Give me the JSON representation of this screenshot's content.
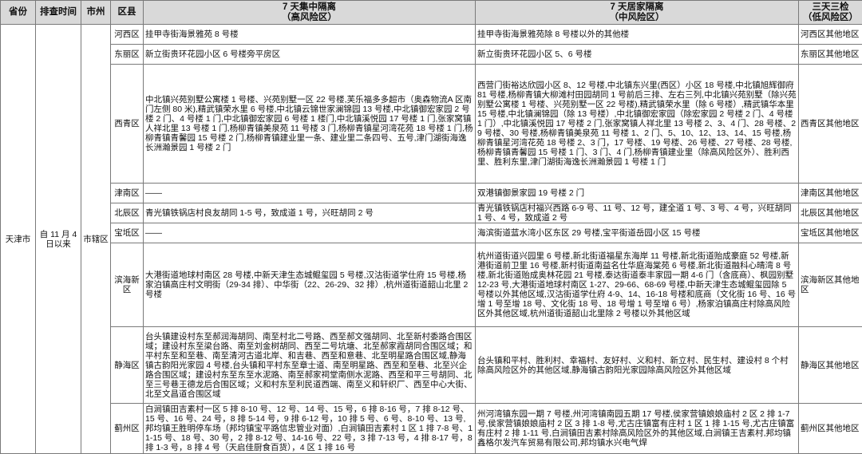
{
  "headers": {
    "province": "省份",
    "check_time": "排查时间",
    "city": "市州",
    "district": "区县",
    "centralized_line1": "7 天集中隔离",
    "centralized_line2": "（高风险区）",
    "home_line1": "7 天居家隔离",
    "home_line2": "（中风险区）",
    "three_day_line1": "三天三检",
    "three_day_line2": "（低风险区）"
  },
  "merged": {
    "province": "天津市",
    "check_time": "自 11 月 4 日以来",
    "city": "市辖区"
  },
  "rows": [
    {
      "district": "河西区",
      "high": "挂甲寺街海景雅苑 8 号楼",
      "mid": "挂甲寺街海景雅苑除 8 号楼以外的其他楼",
      "low": "河西区其他地区"
    },
    {
      "district": "东丽区",
      "high": "新立街贵环花园小区 6 号楼旁平房区",
      "mid": "新立街贵环花园小区 5、6 号楼",
      "low": "东丽区其他地区"
    },
    {
      "district": "西青区",
      "high": "中北镇兴苑别墅公寓楼 1 号楼、兴苑别墅一区 22 号楼,芙乐福多多超市（奥森物流A 区南门左侧 80 米),精武镇荣水里 6 号楼,中北镇云锦世家澜锦园 13 号楼,中北镇御宏家园 2 号楼 2 门、4 号楼 1 门,中北镇御宏家园 6 号楼 1 楼门,中北镇溪悦园 17 号楼 1 门,张家窝镇人祥北里 13 号楼 1 门,杨柳青镇美泉苑 11 号楼 3 门,杨柳青镇星河湾花苑 18 号楼 1 门,杨柳青镇青馨园 15 号楼 2 门,杨柳青镇建业里一条、建业里二条四号、五号,津门湖街海逸长洲瀚景园 1 号楼 2 门",
      "mid": "西营门街裕达欣园小区 8、12 号楼,中北镇东兴里(西区）小区 18 号楼,中北镇旭辉御府 81 号楼,杨柳青镇大柳滩村田园胡同 1 号前后三排、左右三列,中北镇兴苑别墅（除兴苑别墅公寓楼 1 号楼、兴苑别墅一区 22 号楼),精武镇荣水里（除 6 号楼）,精武镇华本里 15 号楼,中北镇澜锦园（除 13 号楼）,中北镇御宏家园（除宏家园 2 号楼 2 门、4 号楼 1 门）,中北镇溪悦园 17 号楼 2 门,张家窝镇人祥北里 13 号楼 2、3、4 门、28 号楼、29 号楼、30 号楼,杨柳青镇美泉苑 11 号楼 1、2 门、5、10、12、13、14、15 号楼,杨柳青镇星河湾花苑 18 号楼 2、3 门，17 号楼、19 号楼、26 号楼、27 号楼、28 号楼,杨柳青镇青馨园 15 号楼 1 门、3 门、4 门,杨柳青镇建业里（除高风险区外）、胜利西里、胜利东里,津门湖街海逸长洲瀚景园 1 号楼 1 门",
      "low": "西青区其他地区"
    },
    {
      "district": "津南区",
      "high": "——",
      "mid": "双港镇御景家园 19 号楼 2 门",
      "low": "津南区其他地区"
    },
    {
      "district": "北辰区",
      "high": "青光镇铁锅店村良友胡同 1-5 号，致成道 1 号，兴旺胡同 2 号",
      "mid": "青光镇铁锅店村福兴西路 6-9 号、11 号、12 号，建全道 1 号、3 号、4 号，兴旺胡同 1 号、4 号，致成道 2 号",
      "low": "北辰区其他地区"
    },
    {
      "district": "宝坻区",
      "high": "——",
      "mid": "海滨街道蓝水湾小区东区 29 号楼,宝平街道岳园小区 15 号楼",
      "low": "宝坻区其他地区"
    },
    {
      "district": "滨海新区",
      "high": "大港街道地球村南区 28 号楼,中新天津生态城鲲玺园 5 号楼,汉沽街道学仕府 15 号楼,杨家泊镇高庄村文明街（29-34 排）、中华街（22、26-29、32 排）,杭州道街道韶山北里 2 号楼",
      "mid": "杭州道街道兴园里 6 号楼,新北街道福星东海岸 11 号楼,新北街道贻成豪庭 52 号楼,新港街道前卫里 16 号楼,新村街道南益名仕华庭海棠苑 6 号楼,新北街道融科心晴湾 8 号楼,新北街道贻成奥林花园 21 号楼,泰达街道泰丰家园一期 4-6 门（含底商）、枫园别墅 12-23 号,大港街道地球村南区 1-27、29-66、68-69 号楼,中新天津生态城鲲玺园除 5 号楼以外其他区域,汉沽街道学仕府 4-9、14、16-18 号楼和底商（文化街 16 号、16 号增 1 号至增 18 号、文化街 18 号、18 号增 1 号至增 6 号）,杨家泊镇高庄村除高风险区外其他区域,杭州道街道韶山北里除 2 号楼以外其他区域",
      "low": "滨海新区其他地区"
    },
    {
      "district": "静海区",
      "high": "台头镇建设村东至郝润海胡同、南至村北二号路、西至郝文强胡同、北至新村委路合围区域；建设村东至梁台路、南至刘金树胡同、西至二号坑塘、北至郝家霞胡同合围区域；和平村东至和至巷、南至清河古道北岸、和吉巷、西至和意巷、北至明星路合围区域,静海镇古韵阳光家园 4 号楼,台头镇和平村东至章士道、南至明星路、西至和至巷、北至兴企路合围区域；建设村东至东至水泥路、南至郝家祠堂南侧水泥路、西至和平三号胡同、北至三号巷王德龙后合围区域；义和村东至利民道西端、南至义和轩织厂、西至中心大街、北至文昌道合围区域",
      "mid": "台头镇和平村、胜利村、幸福村、友好村、义和村、新立村、民生村、建设村 8 个村除高风险区外的其他区域,静海镇古韵阳光家园除高风险区外其他区域",
      "low": "静海区其他地区"
    },
    {
      "district": "蓟州区",
      "high": "白涧镇田吉素村一区 5 排 8-10 号、12 号、14 号、15 号，6 排 8-16 号，7 排 8-12 号、15 号、16 号、24 号，8 排 5-14 号，9 排 6-12 号，10 排 5 号、6 号、8-10 号、13 号,邦均镇王胜明停车场（邦均镇宝平路信忠管业对面）,白涧镇田吉素村 1 区 1 排 7-8 号、11-15 号、18 号、30 号，2 排 8-12 号、14-16 号、22 号，3 排 7-13 号，4 排 8-17 号，8 排 1-3 号，8 排 4 号（天启佳厨食百货），4 区 1 排 16 号",
      "mid": "州河湾镇东园一期 7 号楼,州河湾镇南园五期 17 号楼,侯家营镇娘娘庙村 2 区 2 排 1-7 号,侯家营镇娘娘庙村 2 区 3 排 1-8 号,尤古庄镇富有庄村 1 区 1 排 1-15 号,尤古庄镇富有庄村 2 排 1-11 号,白涧镇田吉素村除高风险区外的其他区域,白涧镇王吉素村,邦均镇鑫格尔发汽车贸易有限公司,邦均镇水兴电气焊",
      "low": "蓟州区其他地区"
    }
  ]
}
